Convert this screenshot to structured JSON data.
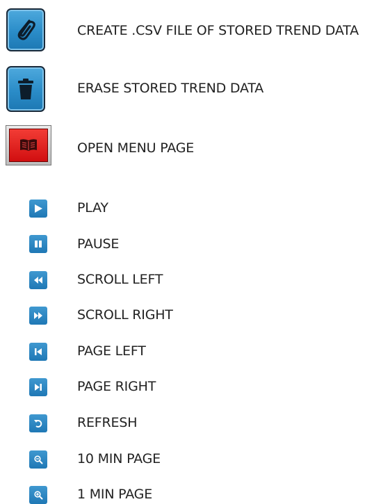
{
  "legend": {
    "items": [
      {
        "icon": "paperclip-icon",
        "label": "CREATE .CSV FILE OF STORED TREND DATA"
      },
      {
        "icon": "trash-icon",
        "label": "ERASE STORED TREND DATA"
      },
      {
        "icon": "book-icon",
        "label": "OPEN MENU PAGE"
      },
      {
        "icon": "play-icon",
        "label": "PLAY"
      },
      {
        "icon": "pause-icon",
        "label": "PAUSE"
      },
      {
        "icon": "scroll-left-icon",
        "label": "SCROLL LEFT"
      },
      {
        "icon": "scroll-right-icon",
        "label": "SCROLL RIGHT"
      },
      {
        "icon": "page-left-icon",
        "label": "PAGE LEFT"
      },
      {
        "icon": "page-right-icon",
        "label": "PAGE RIGHT"
      },
      {
        "icon": "refresh-icon",
        "label": "REFRESH"
      },
      {
        "icon": "zoom-out-icon",
        "label": "10 MIN PAGE"
      },
      {
        "icon": "zoom-in-icon",
        "label": "1 MIN PAGE"
      }
    ]
  },
  "colors": {
    "button_blue": "#2a8cc8",
    "menu_red": "#e01d1d",
    "text": "#222222"
  }
}
